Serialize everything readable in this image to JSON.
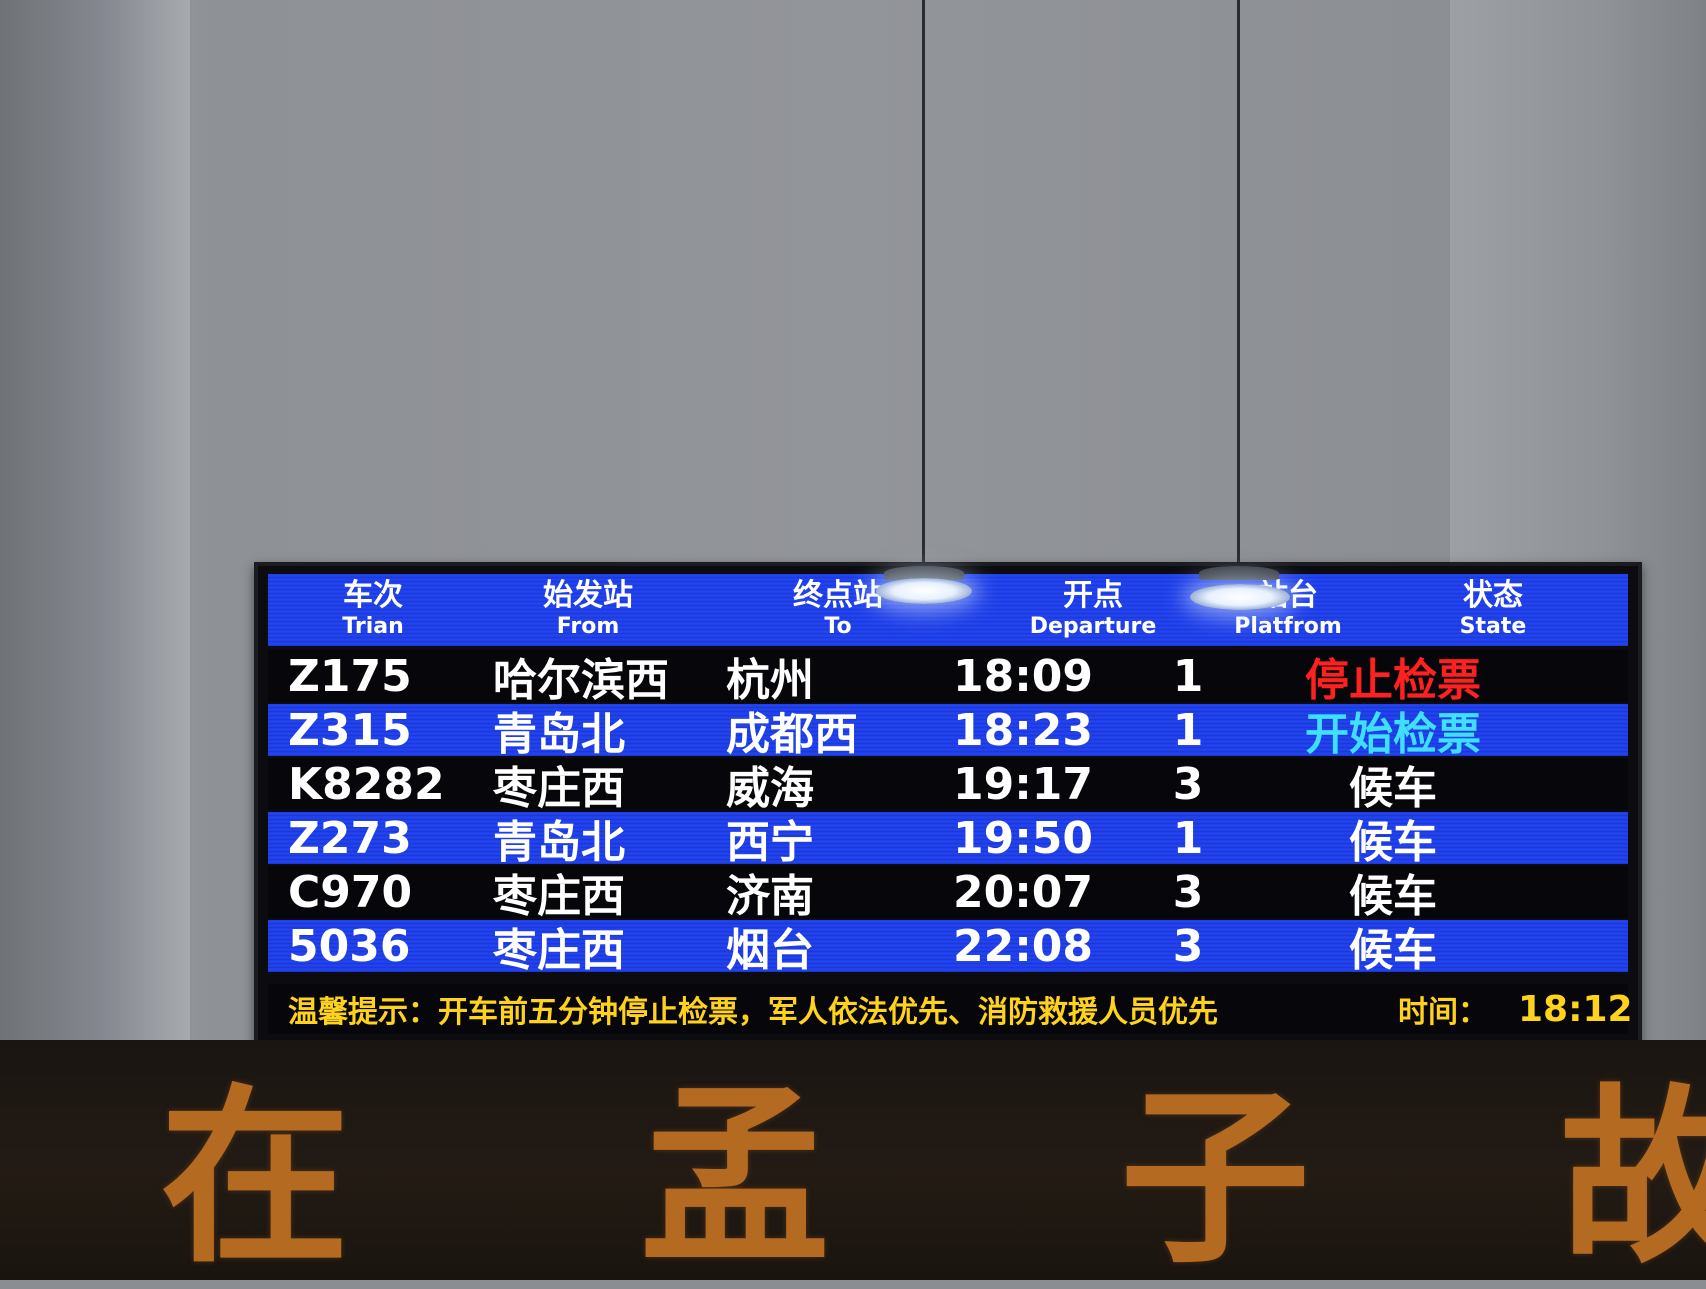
{
  "board": {
    "headers": [
      {
        "zh": "车次",
        "en": "Trian"
      },
      {
        "zh": "始发站",
        "en": "From"
      },
      {
        "zh": "终点站",
        "en": "To"
      },
      {
        "zh": "开点",
        "en": "Departure"
      },
      {
        "zh": "站台",
        "en": "Platfrom"
      },
      {
        "zh": "状态",
        "en": "State"
      }
    ],
    "rows": [
      {
        "train": "Z175",
        "from": "哈尔滨西",
        "to": "杭州",
        "departure": "18:09",
        "platform": "1",
        "state": "停止检票",
        "state_color": "#ff2020"
      },
      {
        "train": "Z315",
        "from": "青岛北",
        "to": "成都西",
        "departure": "18:23",
        "platform": "1",
        "state": "开始检票",
        "state_color": "#3fe0ff"
      },
      {
        "train": "K8282",
        "from": "枣庄西",
        "to": "威海",
        "departure": "19:17",
        "platform": "3",
        "state": "候车",
        "state_color": "#ffffff"
      },
      {
        "train": "Z273",
        "from": "青岛北",
        "to": "西宁",
        "departure": "19:50",
        "platform": "1",
        "state": "候车",
        "state_color": "#ffffff"
      },
      {
        "train": "C970",
        "from": "枣庄西",
        "to": "济南",
        "departure": "20:07",
        "platform": "3",
        "state": "候车",
        "state_color": "#ffffff"
      },
      {
        "train": "5036",
        "from": "枣庄西",
        "to": "烟台",
        "departure": "22:08",
        "platform": "3",
        "state": "候车",
        "state_color": "#ffffff"
      }
    ],
    "notice": "温馨提示：开车前五分钟停止检票，军人依法优先、消防救援人员优先",
    "time_label": "时间：",
    "time_value": "18:12"
  },
  "sign": {
    "characters": [
      "在",
      "孟",
      "子",
      "故"
    ]
  },
  "colors": {
    "row_blue": "#1e3de8",
    "row_black": "#07070b",
    "ticker_yellow": "#ffd21c",
    "sign_gold": "#b56a22"
  }
}
